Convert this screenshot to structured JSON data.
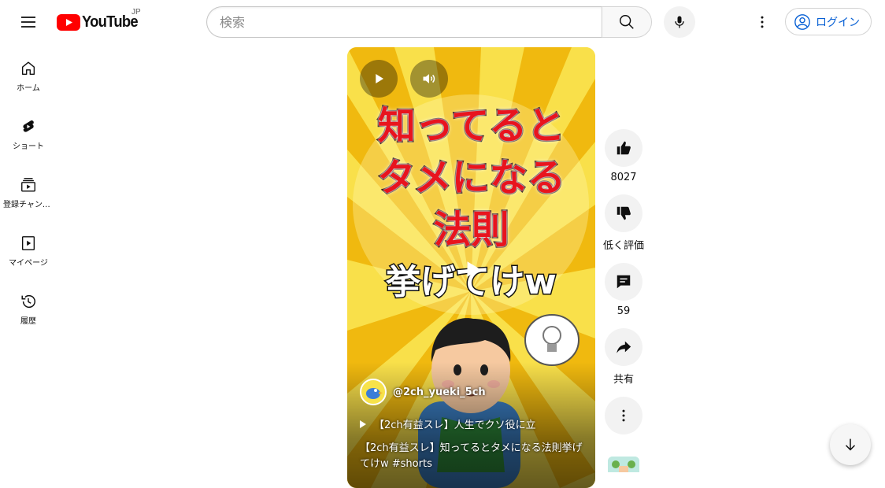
{
  "header": {
    "logo_text": "YouTube",
    "region": "JP",
    "search_placeholder": "検索",
    "signin_label": "ログイン"
  },
  "sidebar": {
    "items": [
      {
        "label": "ホーム",
        "icon": "home-icon"
      },
      {
        "label": "ショート",
        "icon": "shorts-icon"
      },
      {
        "label": "登録チャンネル",
        "icon": "subscriptions-icon"
      },
      {
        "label": "マイページ",
        "icon": "library-icon"
      },
      {
        "label": "履歴",
        "icon": "history-icon"
      }
    ]
  },
  "short": {
    "thumbnail_text": [
      "知ってると",
      "タメになる",
      "法則",
      "挙げてけw"
    ],
    "channel": "@2ch_yueki_5ch",
    "playlist": "【2ch有益スレ】人生でクソ役に立",
    "title": "【2ch有益スレ】知ってるとタメになる法則挙げてけw #shorts"
  },
  "actions": {
    "like_count": "8027",
    "dislike_label": "低く評価",
    "comment_count": "59",
    "share_label": "共有"
  },
  "colors": {
    "brand_red": "#ff0000",
    "link_blue": "#065fd4",
    "thumb_yellow": "#f5d31a"
  }
}
